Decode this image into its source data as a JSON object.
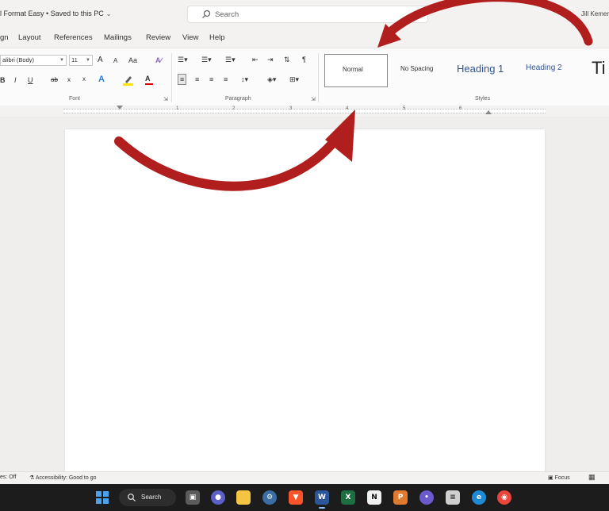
{
  "window": {
    "doc_title": "l Format Easy • Saved to this PC",
    "search_label": "Search",
    "user_name": "Jill Kemer"
  },
  "tabs": [
    "gn",
    "Layout",
    "References",
    "Mailings",
    "Review",
    "View",
    "Help"
  ],
  "ribbon": {
    "font_name": "alibri (Body)",
    "font_size": "11",
    "grow_font": "A",
    "shrink_font": "A",
    "change_case": "Aa",
    "bold": "B",
    "italic": "I",
    "underline": "U",
    "strikethrough": "ab",
    "subscript": "x",
    "superscript": "x",
    "text_effects": "A",
    "font_color": "A",
    "font_group_label": "Font",
    "paragraph_group_label": "Paragraph",
    "styles_group_label": "Styles",
    "pilcrow": "¶",
    "colors": {
      "highlight": "#ffe600",
      "font_color": "#e00000",
      "text_effect": "#2b7cd3"
    }
  },
  "styles": [
    {
      "name": "Normal"
    },
    {
      "name": "No Spacing"
    },
    {
      "name": "Heading 1"
    },
    {
      "name": "Heading 2"
    },
    {
      "name": "Ti"
    }
  ],
  "ruler": {
    "numbers": [
      "1",
      "2",
      "3",
      "4",
      "5",
      "6"
    ]
  },
  "status": {
    "words": "es: Off",
    "accessibility": "Accessibility: Good to go",
    "focus": "Focus"
  },
  "taskbar": {
    "search_label": "Search",
    "apps": [
      "file-explorer",
      "teams-chat",
      "folder",
      "settings",
      "brave",
      "word",
      "excel",
      "notion",
      "powerpoint",
      "app",
      "calculator",
      "edge",
      "chrome"
    ]
  },
  "annotation": {
    "color": "#b01e1e"
  }
}
